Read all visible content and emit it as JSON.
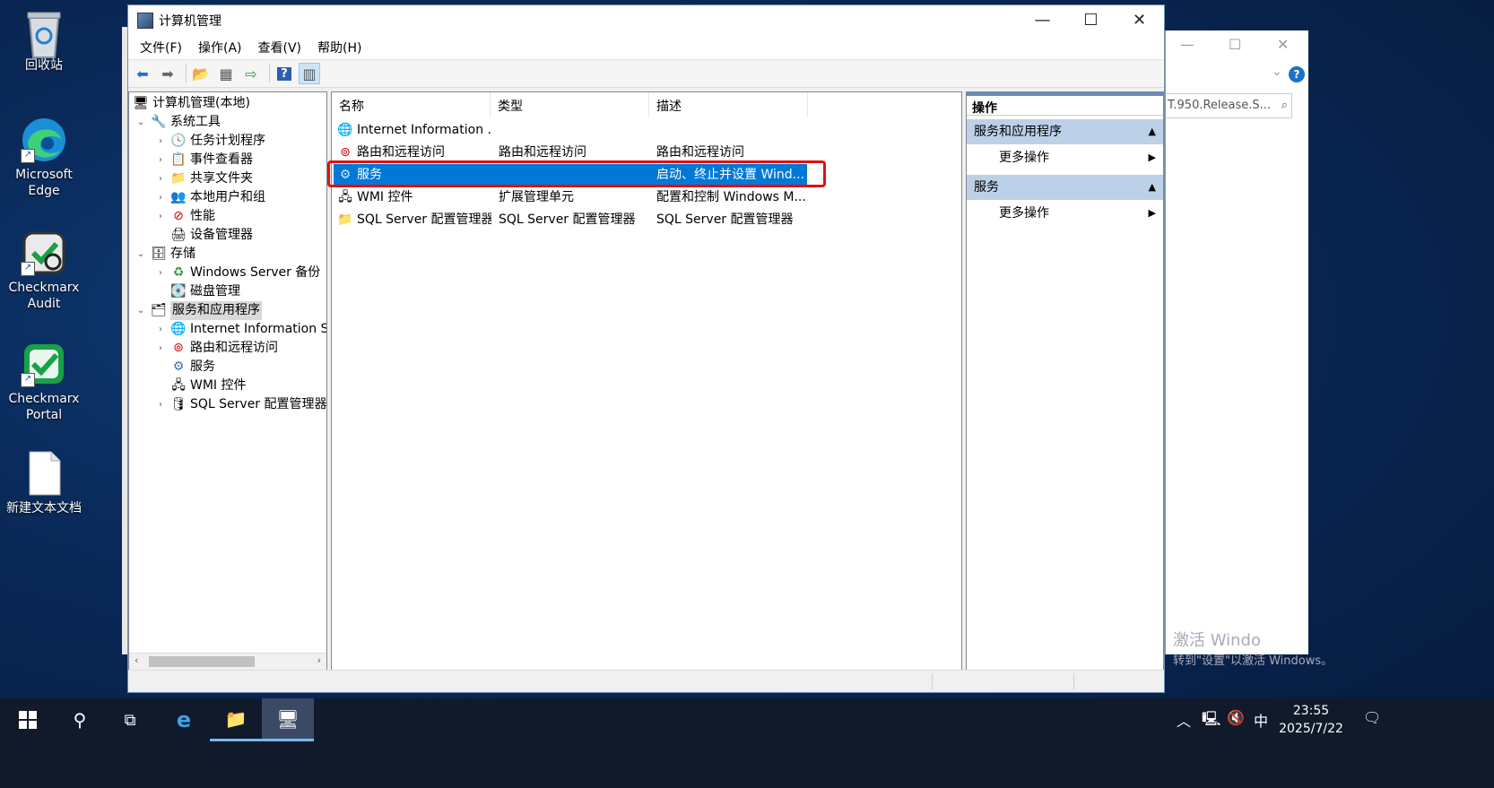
{
  "desktop": {
    "icons": [
      {
        "label": "回收站",
        "icon": "recycle-bin-icon"
      },
      {
        "label": "Microsoft Edge",
        "icon": "edge-icon"
      },
      {
        "label": "Checkmarx Audit",
        "icon": "checkmarx-audit-icon"
      },
      {
        "label": "Checkmarx Portal",
        "icon": "checkmarx-portal-icon"
      },
      {
        "label": "新建文本文档",
        "icon": "text-document-icon"
      }
    ]
  },
  "bg_window": {
    "search_text": "T.950.Release.S...",
    "watermark_line1": "激活 Windo",
    "watermark_line2": "转到\"设置\"以激活 Windows。"
  },
  "window": {
    "title": "计算机管理",
    "menu": [
      "文件(F)",
      "操作(A)",
      "查看(V)",
      "帮助(H)"
    ]
  },
  "tree": {
    "root": "计算机管理(本地)",
    "system_tools": "系统工具",
    "task_scheduler": "任务计划程序",
    "event_viewer": "事件查看器",
    "shared_folders": "共享文件夹",
    "local_users": "本地用户和组",
    "performance": "性能",
    "device_manager": "设备管理器",
    "storage": "存储",
    "windows_backup": "Windows Server 备份",
    "disk_management": "磁盘管理",
    "services_apps": "服务和应用程序",
    "iis": "Internet Information Se",
    "routing": "路由和远程访问",
    "services": "服务",
    "wmi": "WMI 控件",
    "sql_config": "SQL Server 配置管理器"
  },
  "list": {
    "columns": [
      "名称",
      "类型",
      "描述"
    ],
    "rows": [
      {
        "name": "Internet Information ...",
        "type": "",
        "desc": ""
      },
      {
        "name": "路由和远程访问",
        "type": "路由和远程访问",
        "desc": "路由和远程访问"
      },
      {
        "name": "服务",
        "type": "",
        "desc": "启动、终止并设置 Wind..."
      },
      {
        "name": "WMI 控件",
        "type": "扩展管理单元",
        "desc": "配置和控制 Windows M..."
      },
      {
        "name": "SQL Server 配置管理器",
        "type": "SQL Server 配置管理器",
        "desc": "SQL Server 配置管理器"
      }
    ]
  },
  "actions": {
    "title": "操作",
    "section1": "服务和应用程序",
    "more1": "更多操作",
    "section2": "服务",
    "more2": "更多操作"
  },
  "taskbar": {
    "clock_time": "23:55",
    "clock_date": "2025/7/22",
    "ime": "中"
  }
}
